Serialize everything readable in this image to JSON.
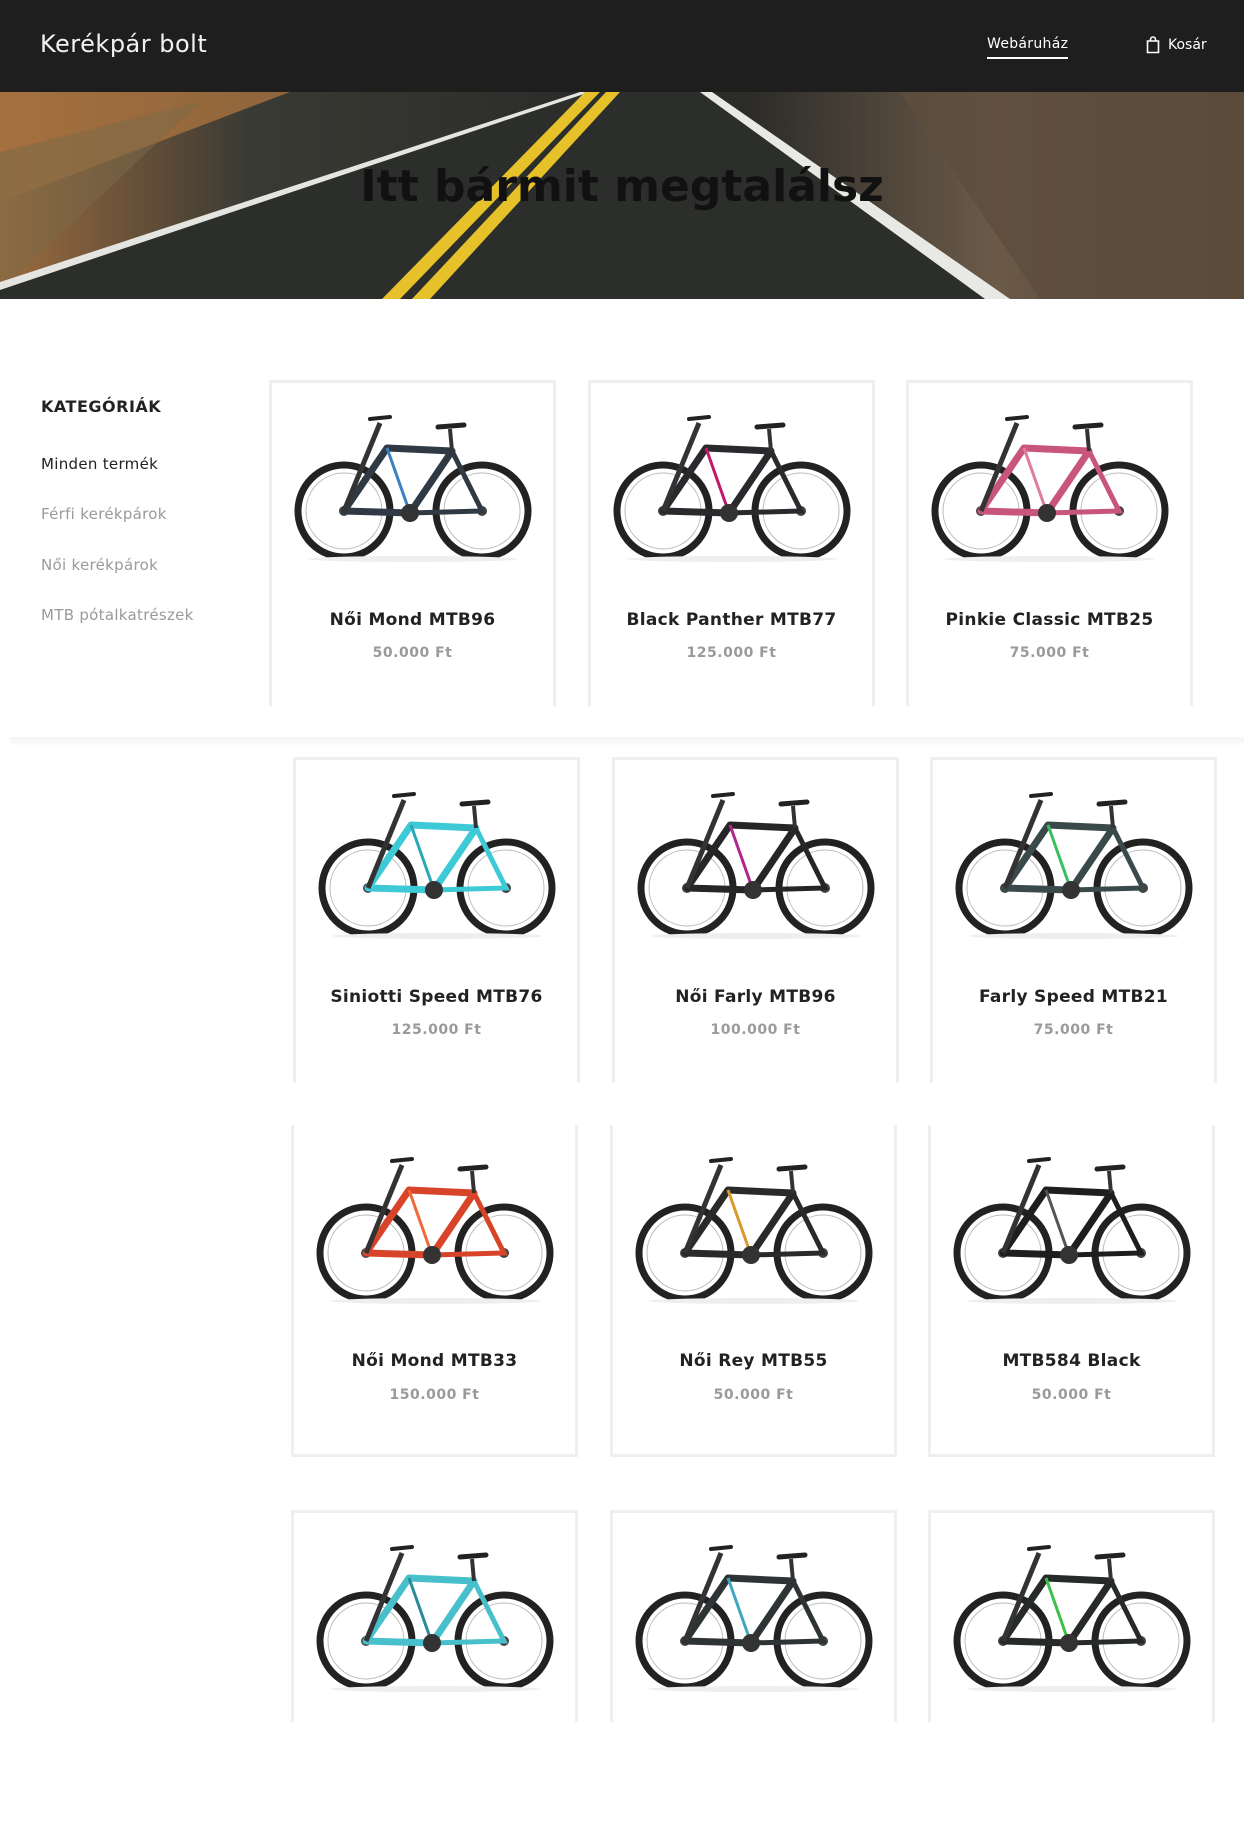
{
  "header": {
    "brand": "Kerékpár bolt",
    "nav_link": "Webáruház",
    "cart_label": "Kosár",
    "cart_icon": "shopping-bag-icon"
  },
  "hero": {
    "title": "Itt bármit megtalálsz"
  },
  "sidebar": {
    "heading": "KATEGÓRIÁK",
    "items": [
      {
        "label": "Minden termék",
        "active": true
      },
      {
        "label": "Férfi kerékpárok",
        "active": false
      },
      {
        "label": "Női kerékpárok",
        "active": false
      },
      {
        "label": "MTB pótalkatrészek",
        "active": false
      }
    ]
  },
  "products": [
    {
      "name": "Női Mond MTB96",
      "price": "50.000 Ft",
      "frame": "#2f3a45",
      "accent": "#3a7fc0"
    },
    {
      "name": "Black Panther MTB77",
      "price": "125.000 Ft",
      "frame": "#2a2a2e",
      "accent": "#c2186b"
    },
    {
      "name": "Pinkie Classic MTB25",
      "price": "75.000 Ft",
      "frame": "#c8557a",
      "accent": "#e07aa0"
    },
    {
      "name": "Siniotti Speed MTB76",
      "price": "125.000 Ft",
      "frame": "#3ec9d6",
      "accent": "#2aa8b8"
    },
    {
      "name": "Női Farly MTB96",
      "price": "100.000 Ft",
      "frame": "#262626",
      "accent": "#b0288e"
    },
    {
      "name": "Farly Speed MTB21",
      "price": "75.000 Ft",
      "frame": "#3a4a4a",
      "accent": "#38c060"
    },
    {
      "name": "Női Mond MTB33",
      "price": "150.000 Ft",
      "frame": "#d8442a",
      "accent": "#ee6a3a"
    },
    {
      "name": "Női Rey MTB55",
      "price": "50.000 Ft",
      "frame": "#2a2a2a",
      "accent": "#d89a2a"
    },
    {
      "name": "MTB584 Black",
      "price": "50.000 Ft",
      "frame": "#1e1e1e",
      "accent": "#555555"
    },
    {
      "frame": "#48c0cc",
      "accent": "#2a8c9a"
    },
    {
      "frame": "#2e3436",
      "accent": "#3fa8c0"
    },
    {
      "frame": "#262a28",
      "accent": "#3cc04a"
    }
  ]
}
